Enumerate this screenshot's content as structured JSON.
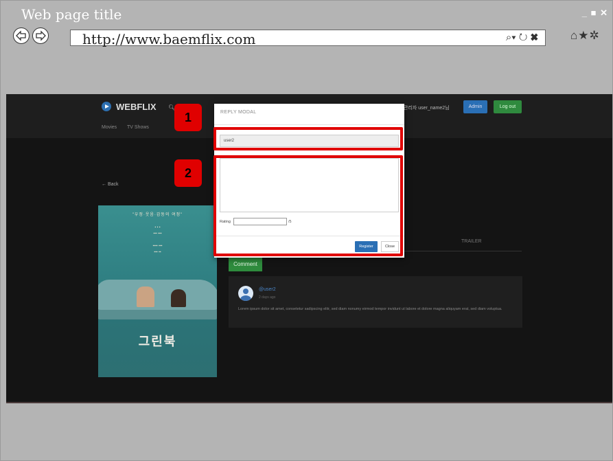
{
  "browser": {
    "title": "Web page title",
    "window_controls": "_ ■ ✕",
    "url": "http://www.baemflix.com",
    "url_controls": "⌕▾ ↻ ✖",
    "toolbar_icons": "⌂★✲"
  },
  "site": {
    "logo": "WEBFLIX",
    "nav": [
      "Movies",
      "TV Shows"
    ],
    "greeting": "관리자 user_name2님",
    "admin_label": "Admin",
    "logout_label": "Log out",
    "back_label": "← Back",
    "tab_trailer": "TRAILER",
    "comment_button": "Comment"
  },
  "poster": {
    "title": "그린북",
    "tagline": "\"우정·웃음·감동의 여정\""
  },
  "comment": {
    "user": "@user2",
    "time": "2 days ago",
    "text": "Lorem ipsum dolor sit amet, consetetur sadipscing elitr, sed diam nonumy eirmod tempor invidunt ut labore et dolore magna aliquyam erat, sed diam voluptua."
  },
  "modal": {
    "title": "REPLY MODAL",
    "user_value": "user2",
    "rating_label": "Rating",
    "rating_max": "/5",
    "register_label": "Register",
    "close_label": "Close"
  },
  "annotations": {
    "badge1": "1",
    "badge2": "2",
    "highlight_color": "#e00000"
  }
}
